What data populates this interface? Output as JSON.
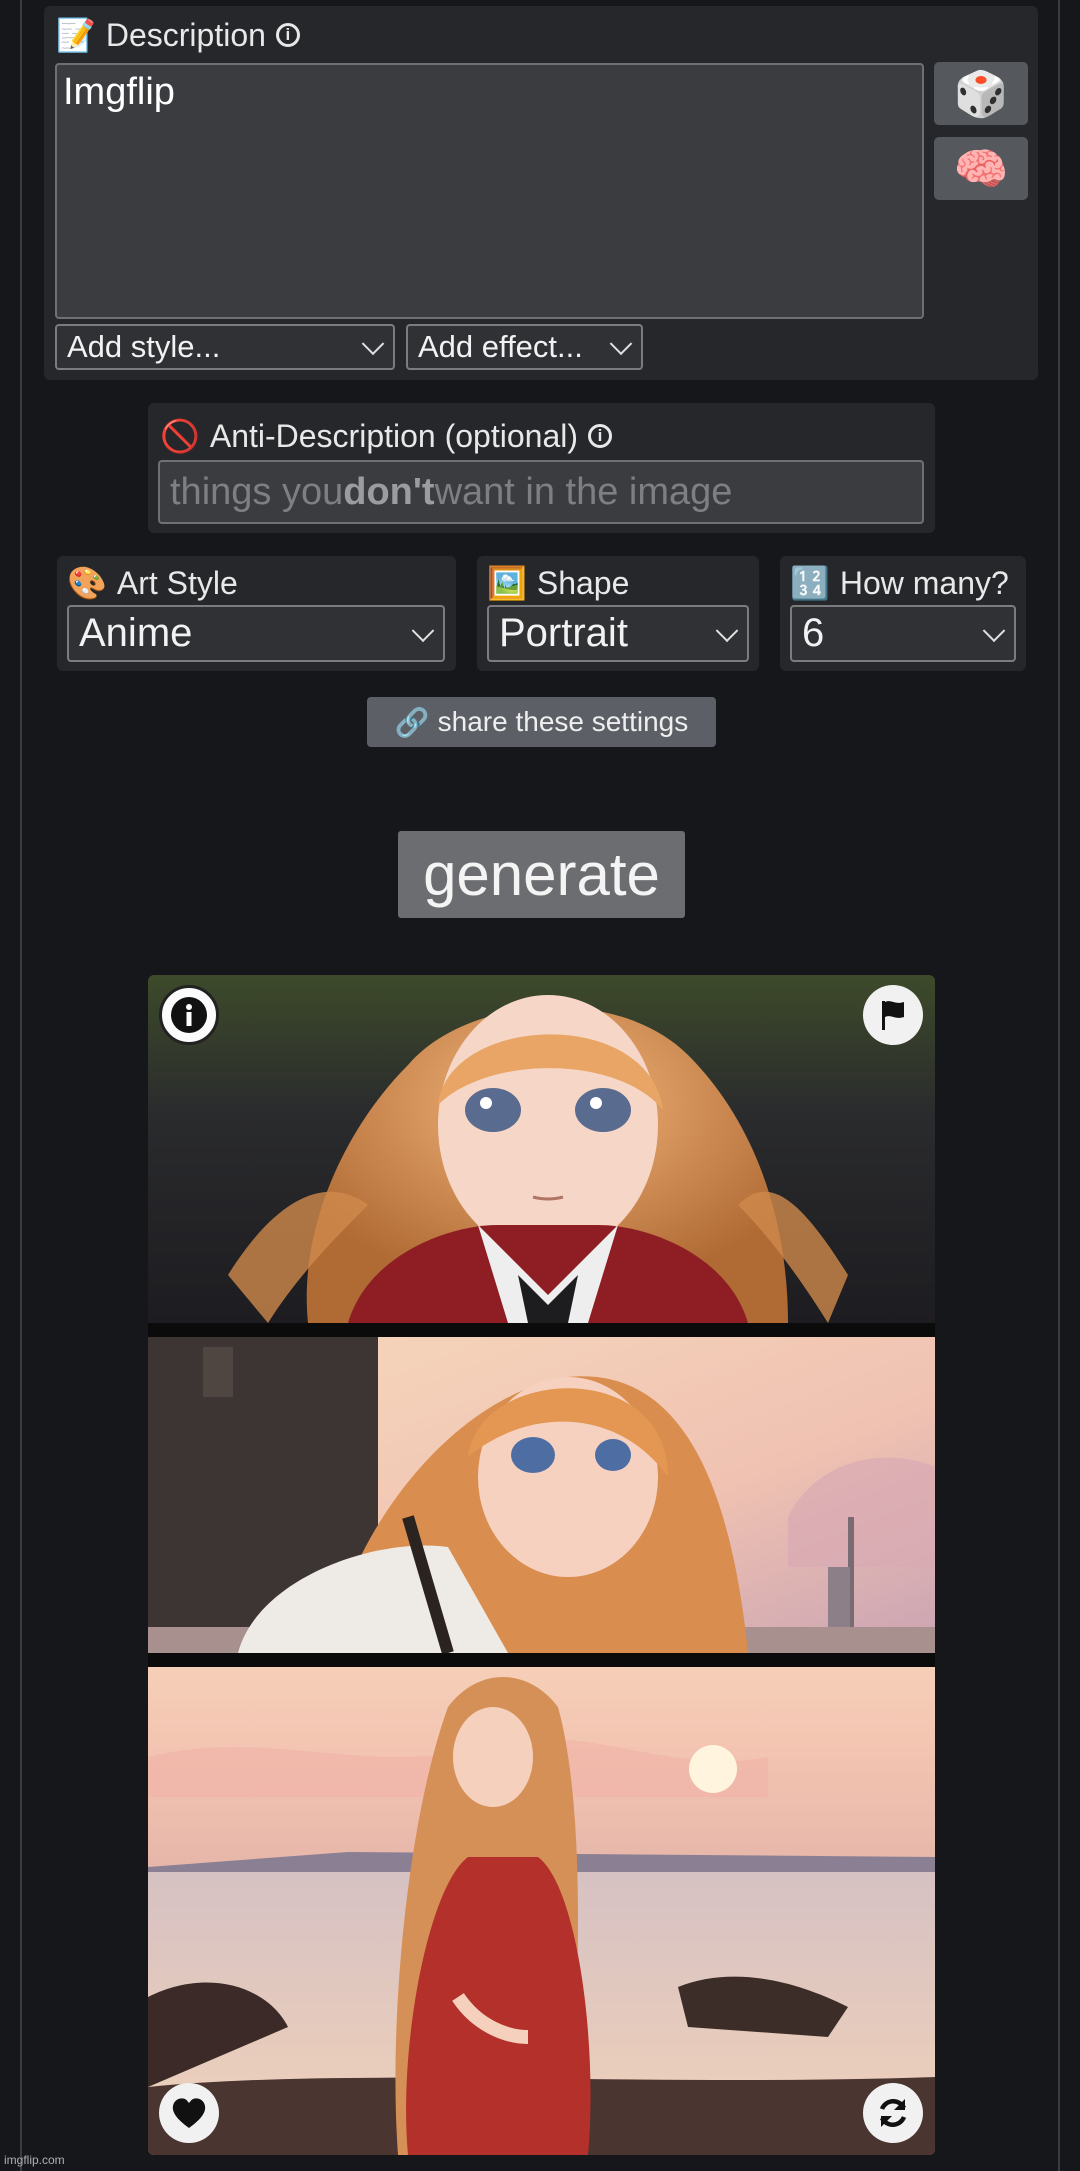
{
  "description": {
    "label": "Description",
    "label_emoji": "📝",
    "value": "Imgflip",
    "random_button_icon": "🎲",
    "brain_button_icon": "🧠",
    "style_select": "Add style...",
    "effect_select": "Add effect..."
  },
  "anti_description": {
    "label": "Anti-Description (optional)",
    "label_emoji": "🚫",
    "placeholder_pre": "things you ",
    "placeholder_bold": "don't",
    "placeholder_post": " want in the image"
  },
  "art_style": {
    "label": "Art Style",
    "emoji": "🎨",
    "value": "Anime"
  },
  "shape": {
    "label": "Shape",
    "emoji": "🖼️",
    "value": "Portrait"
  },
  "how_many": {
    "label": "How many?",
    "emoji": "🔢",
    "value": "6"
  },
  "share_button": {
    "icon": "🔗",
    "label": "share these settings"
  },
  "generate_button": {
    "label": "generate"
  },
  "watermark": "imgflip.com",
  "colors": {
    "page_bg": "#15171a",
    "panel_bg": "#25272b",
    "button_gray": "#6b6d70"
  }
}
